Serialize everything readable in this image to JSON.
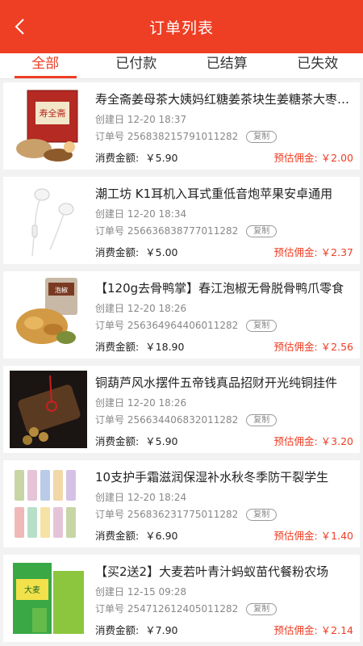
{
  "header": {
    "title": "订单列表",
    "back_icon": "chevron-left-icon"
  },
  "tabs": [
    {
      "label": "全部",
      "active": true
    },
    {
      "label": "已付款",
      "active": false
    },
    {
      "label": "已结算",
      "active": false
    },
    {
      "label": "已失效",
      "active": false
    }
  ],
  "labels": {
    "created": "创建日",
    "order_no": "订单号",
    "copy": "复制",
    "amount": "消费金额:",
    "commission": "预估佣金:"
  },
  "colors": {
    "accent": "#ee3e24"
  },
  "orders": [
    {
      "name": "寿全斋姜母茶大姨妈红糖姜茶块生姜糖茶大枣桂圆",
      "date": "12-20 18:37",
      "order_no": "256838215791011282",
      "amount": "￥5.90",
      "commission": "￥2.00",
      "image": "ginger-tea-package"
    },
    {
      "name": "潮工坊 K1耳机入耳式重低音炮苹果安卓通用",
      "date": "12-20 18:34",
      "order_no": "256636838777011282",
      "amount": "￥5.00",
      "commission": "￥2.37",
      "image": "white-earphones"
    },
    {
      "name": "【120g去骨鸭掌】春江泡椒无骨脱骨鸭爪零食",
      "date": "12-20 18:26",
      "order_no": "256364964406011282",
      "amount": "￥18.90",
      "commission": "￥2.56",
      "image": "duck-feet-snack"
    },
    {
      "name": "铜葫芦风水摆件五帝钱真品招财开光纯铜挂件",
      "date": "12-20 18:26",
      "order_no": "256634406832011282",
      "amount": "￥5.90",
      "commission": "￥3.20",
      "image": "copper-gourd"
    },
    {
      "name": "10支护手霜滋润保湿补水秋冬季防干裂学生",
      "date": "12-20 18:24",
      "order_no": "256836231775011282",
      "amount": "￥6.90",
      "commission": "￥1.40",
      "image": "hand-cream-set"
    },
    {
      "name": "【买2送2】大麦若叶青汁蚂蚁苗代餐粉农场",
      "date": "12-15 09:28",
      "order_no": "254712612405011282",
      "amount": "￥7.90",
      "commission": "￥2.14",
      "image": "barley-grass-juice"
    }
  ]
}
